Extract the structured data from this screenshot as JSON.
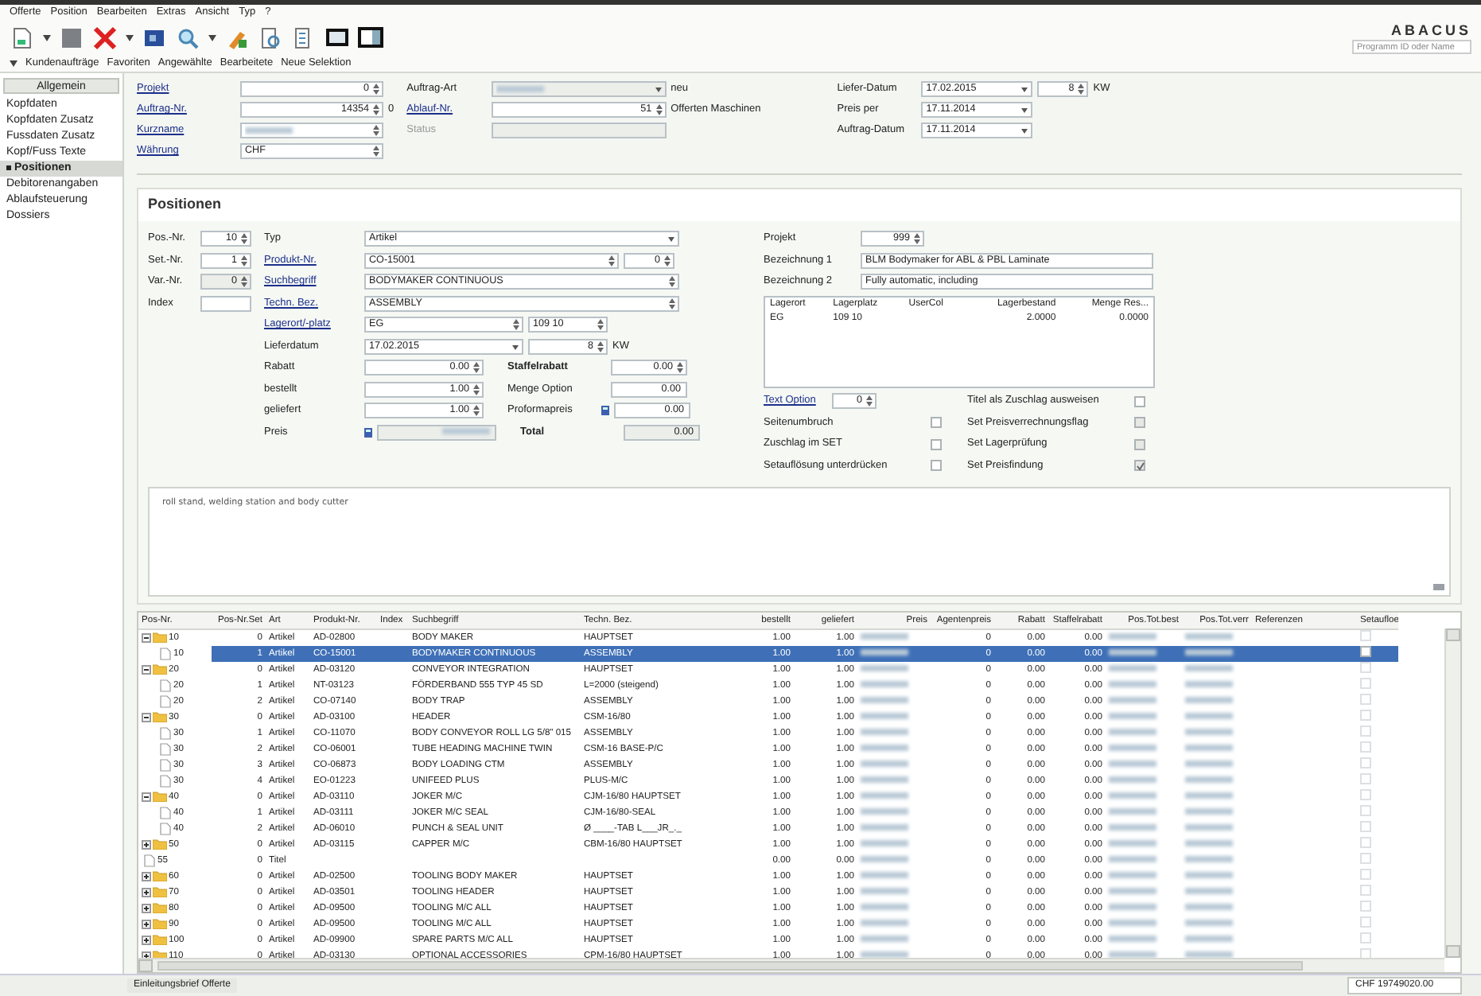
{
  "menu": [
    "Offerte",
    "Position",
    "Bearbeiten",
    "Extras",
    "Ansicht",
    "Typ",
    "?"
  ],
  "nav_tabs": [
    "Kundenaufträge",
    "Favoriten",
    "Angewählte",
    "Bearbeitete",
    "Neue Selektion"
  ],
  "logo": "ABACUS",
  "program_search": {
    "placeholder": "Programm ID oder Name"
  },
  "sidebar": {
    "header": "Allgemein",
    "items": [
      {
        "label": "Kopfdaten",
        "selected": false
      },
      {
        "label": "Kopfdaten Zusatz",
        "selected": false
      },
      {
        "label": "Fussdaten Zusatz",
        "selected": false
      },
      {
        "label": "Kopf/Fuss Texte",
        "selected": false
      },
      {
        "label": "Positionen",
        "selected": true
      },
      {
        "label": "Debitorenangaben",
        "selected": false
      },
      {
        "label": "Ablaufsteuerung",
        "selected": false
      },
      {
        "label": "Dossiers",
        "selected": false
      }
    ]
  },
  "header": {
    "groups": [
      [
        {
          "label": "Projekt",
          "link": true,
          "inputs": [
            {
              "kind": "spin",
              "value": "0"
            }
          ]
        },
        {
          "label": "Auftrag-Nr.",
          "link": true,
          "inputs": [
            {
              "kind": "spin",
              "value": "14354"
            }
          ],
          "suffix": "0"
        },
        {
          "label": "Kurzname",
          "link": true,
          "inputs": [
            {
              "kind": "lookup",
              "redacted": true
            }
          ]
        },
        {
          "label": "Währung",
          "link": true,
          "inputs": [
            {
              "kind": "lookup",
              "value": "CHF"
            }
          ]
        }
      ],
      [
        {
          "label": "Auftrag-Art",
          "inputs": [
            {
              "kind": "combo",
              "disabled": true,
              "redacted": true
            }
          ],
          "suffix": "neu"
        },
        {
          "label": "Ablauf-Nr.",
          "link": true,
          "inputs": [
            {
              "kind": "spin",
              "value": "51"
            }
          ],
          "suffix": "Offerten Maschinen"
        },
        {
          "label": "Status",
          "disabled": true,
          "inputs": [
            {
              "kind": "text",
              "disabled": true
            }
          ]
        }
      ],
      [
        {
          "label": "Liefer-Datum",
          "inputs": [
            {
              "kind": "date",
              "value": "17.02.2015"
            },
            {
              "kind": "spin",
              "value": "8"
            }
          ],
          "suffix": "KW"
        },
        {
          "label": "Preis per",
          "inputs": [
            {
              "kind": "date",
              "value": "17.11.2014"
            }
          ]
        },
        {
          "label": "Auftrag-Datum",
          "inputs": [
            {
              "kind": "date",
              "value": "17.11.2014"
            }
          ]
        }
      ]
    ]
  },
  "positionen": {
    "title": "Positionen",
    "pos_fields": [
      {
        "label": "Pos.-Nr.",
        "inputs": [
          {
            "kind": "spin",
            "value": "10"
          }
        ]
      },
      {
        "label": "Set.-Nr.",
        "inputs": [
          {
            "kind": "spin",
            "value": "1"
          }
        ]
      },
      {
        "label": "Var.-Nr.",
        "inputs": [
          {
            "kind": "spin",
            "value": "0",
            "disabled": true
          }
        ]
      },
      {
        "label": "Index",
        "inputs": [
          {
            "kind": "text"
          }
        ]
      }
    ],
    "item_fields": [
      {
        "label": "Typ",
        "inputs": [
          {
            "kind": "combo",
            "value": "Artikel"
          }
        ]
      },
      {
        "label": "Produkt-Nr.",
        "link": true,
        "inputs": [
          {
            "kind": "lookup",
            "value": "CO-15001"
          },
          {
            "kind": "spin",
            "value": "0"
          }
        ]
      },
      {
        "label": "Suchbegriff",
        "link": true,
        "inputs": [
          {
            "kind": "lookup",
            "value": "BODYMAKER CONTINUOUS"
          }
        ]
      },
      {
        "label": "Techn. Bez.",
        "link": true,
        "inputs": [
          {
            "kind": "lookup",
            "value": "ASSEMBLY"
          }
        ]
      },
      {
        "label": "Lagerort/-platz",
        "link": true,
        "inputs": [
          {
            "kind": "lookup",
            "value": "EG"
          },
          {
            "kind": "lookup",
            "value": "109 10"
          }
        ]
      },
      {
        "label": "Lieferdatum",
        "inputs": [
          {
            "kind": "date",
            "value": "17.02.2015"
          },
          {
            "kind": "spin",
            "value": "8"
          }
        ],
        "suffix": "KW"
      },
      {
        "label": "Rabatt",
        "inputs": [
          {
            "kind": "spin",
            "value": "0.00"
          }
        ],
        "side": {
          "label": "Staffelrabatt",
          "bold": true,
          "inputs": [
            {
              "kind": "spin",
              "value": "0.00"
            }
          ]
        }
      },
      {
        "label": "bestellt",
        "inputs": [
          {
            "kind": "spin",
            "value": "1.00"
          }
        ],
        "side": {
          "label": "Menge Option",
          "inputs": [
            {
              "kind": "num",
              "value": "0.00"
            }
          ]
        }
      },
      {
        "label": "geliefert",
        "inputs": [
          {
            "kind": "spin",
            "value": "1.00"
          }
        ],
        "side": {
          "label": "Proformapreis",
          "label_icon": true,
          "inputs": [
            {
              "kind": "num",
              "value": "0.00"
            }
          ]
        }
      },
      {
        "label": "Preis",
        "label_icon": true,
        "inputs": [
          {
            "kind": "num",
            "disabled": true,
            "redacted": true
          }
        ],
        "side": {
          "label": "Total",
          "bold": true,
          "inputs": [
            {
              "kind": "num",
              "value": "0.00",
              "disabled": true
            }
          ]
        }
      }
    ],
    "right_fields": [
      {
        "label": "Projekt",
        "inputs": [
          {
            "kind": "spin",
            "value": "999"
          }
        ]
      },
      {
        "label": "Bezeichnung 1",
        "inputs": [
          {
            "kind": "text",
            "value": "BLM Bodymaker for ABL & PBL Laminate"
          }
        ]
      },
      {
        "label": "Bezeichnung 2",
        "inputs": [
          {
            "kind": "text",
            "value": "Fully automatic, including"
          }
        ]
      }
    ],
    "stock_table": {
      "columns": [
        "Lagerort",
        "Lagerplatz",
        "UserCol",
        "Lagerbestand",
        "Menge Res..."
      ],
      "rows": [
        [
          "EG",
          "109 10",
          null,
          "2.0000",
          "0.0000"
        ]
      ]
    },
    "text_option": {
      "label": "Text Option",
      "link": true,
      "value": "0"
    },
    "checks_left": [
      {
        "label": "Seitenumbruch",
        "checked": false,
        "disabled": false
      },
      {
        "label": "Zuschlag im SET",
        "checked": false,
        "disabled": false
      },
      {
        "label": "Setauflösung unterdrücken",
        "checked": false,
        "disabled": false
      }
    ],
    "checks_right": [
      {
        "label": "Titel als Zuschlag ausweisen",
        "checked": false,
        "disabled": false
      },
      {
        "label": "Set Preisverrechnungsflag",
        "checked": false,
        "disabled": true
      },
      {
        "label": "Set Lagerprüfung",
        "checked": false,
        "disabled": true
      },
      {
        "label": "Set Preisfindung",
        "checked": true,
        "disabled": true
      }
    ],
    "text": "roll stand, welding station and body cutter"
  },
  "grid": {
    "columns": [
      {
        "label": "Pos-Nr.",
        "kind": "tree"
      },
      {
        "label": "Pos-Nr.Set",
        "kind": "num"
      },
      {
        "label": "Art",
        "kind": "text"
      },
      {
        "label": "Produkt-Nr.",
        "kind": "text"
      },
      {
        "label": "Index",
        "kind": "empty"
      },
      {
        "label": "Suchbegriff",
        "kind": "text"
      },
      {
        "label": "Techn. Bez.",
        "kind": "text"
      },
      {
        "label": "bestellt",
        "kind": "num"
      },
      {
        "label": "geliefert",
        "kind": "num"
      },
      {
        "label": "Preis",
        "kind": "blurred"
      },
      {
        "label": "Agentenpreis",
        "kind": "num"
      },
      {
        "label": "Rabatt",
        "kind": "num"
      },
      {
        "label": "Staffelrabatt",
        "kind": "num"
      },
      {
        "label": "Pos.Tot.best",
        "kind": "blurred"
      },
      {
        "label": "Pos.Tot.verr",
        "kind": "blurred"
      },
      {
        "label": "Referenzen",
        "kind": "empty"
      },
      {
        "label": "Setaufloe",
        "kind": "check"
      }
    ],
    "rows": [
      {
        "cells": [
          "10",
          "0",
          "Artikel",
          "AD-02800",
          "",
          "BODY MAKER",
          "HAUPTSET",
          "1.00",
          "1.00",
          "",
          "0",
          "0.00",
          "0.00",
          "",
          "",
          "",
          ""
        ],
        "expanded": true,
        "selected": false,
        "checked": false,
        "children": [
          {
            "cells": [
              "10",
              "1",
              "Artikel",
              "CO-15001",
              "",
              "BODYMAKER CONTINUOUS",
              "ASSEMBLY",
              "1.00",
              "1.00",
              "",
              "0",
              "0.00",
              "0.00",
              "",
              "",
              "",
              ""
            ],
            "selected": true,
            "checked": false
          }
        ]
      },
      {
        "cells": [
          "20",
          "0",
          "Artikel",
          "AD-03120",
          "",
          "CONVEYOR INTEGRATION",
          "HAUPTSET",
          "1.00",
          "1.00",
          "",
          "0",
          "0.00",
          "0.00",
          "",
          "",
          "",
          ""
        ],
        "expanded": true,
        "selected": false,
        "checked": false,
        "children": [
          {
            "cells": [
              "20",
              "1",
              "Artikel",
              "NT-03123",
              "",
              "FÖRDERBAND 555 TYP 45 SD",
              "L=2000 (steigend)",
              "1.00",
              "1.00",
              "",
              "0",
              "0.00",
              "0.00",
              "",
              "",
              "",
              ""
            ],
            "selected": false,
            "checked": false
          },
          {
            "cells": [
              "20",
              "2",
              "Artikel",
              "CO-07140",
              "",
              "BODY TRAP",
              "ASSEMBLY",
              "1.00",
              "1.00",
              "",
              "0",
              "0.00",
              "0.00",
              "",
              "",
              "",
              ""
            ],
            "selected": false,
            "checked": false
          }
        ]
      },
      {
        "cells": [
          "30",
          "0",
          "Artikel",
          "AD-03100",
          "",
          "HEADER",
          "CSM-16/80",
          "1.00",
          "1.00",
          "",
          "0",
          "0.00",
          "0.00",
          "",
          "",
          "",
          ""
        ],
        "expanded": true,
        "selected": false,
        "checked": false,
        "children": [
          {
            "cells": [
              "30",
              "1",
              "Artikel",
              "CO-11070",
              "",
              "BODY CONVEYOR ROLL LG 5/8\" 015",
              "ASSEMBLY",
              "1.00",
              "1.00",
              "",
              "0",
              "0.00",
              "0.00",
              "",
              "",
              "",
              ""
            ],
            "selected": false,
            "checked": false
          },
          {
            "cells": [
              "30",
              "2",
              "Artikel",
              "CO-06001",
              "",
              "TUBE HEADING MACHINE TWIN",
              "CSM-16  BASE-P/C",
              "1.00",
              "1.00",
              "",
              "0",
              "0.00",
              "0.00",
              "",
              "",
              "",
              ""
            ],
            "selected": false,
            "checked": false
          },
          {
            "cells": [
              "30",
              "3",
              "Artikel",
              "CO-06873",
              "",
              "BODY LOADING    CTM",
              "ASSEMBLY",
              "1.00",
              "1.00",
              "",
              "0",
              "0.00",
              "0.00",
              "",
              "",
              "",
              ""
            ],
            "selected": false,
            "checked": false
          },
          {
            "cells": [
              "30",
              "4",
              "Artikel",
              "EO-01223",
              "",
              "UNIFEED PLUS",
              "PLUS-M/C",
              "1.00",
              "1.00",
              "",
              "0",
              "0.00",
              "0.00",
              "",
              "",
              "",
              ""
            ],
            "selected": false,
            "checked": false
          }
        ]
      },
      {
        "cells": [
          "40",
          "0",
          "Artikel",
          "AD-03110",
          "",
          "JOKER M/C",
          "CJM-16/80  HAUPTSET",
          "1.00",
          "1.00",
          "",
          "0",
          "0.00",
          "0.00",
          "",
          "",
          "",
          ""
        ],
        "expanded": true,
        "selected": false,
        "checked": false,
        "children": [
          {
            "cells": [
              "40",
              "1",
              "Artikel",
              "AD-03111",
              "",
              "JOKER M/C SEAL",
              "CJM-16/80-SEAL",
              "1.00",
              "1.00",
              "",
              "0",
              "0.00",
              "0.00",
              "",
              "",
              "",
              ""
            ],
            "selected": false,
            "checked": false
          },
          {
            "cells": [
              "40",
              "2",
              "Artikel",
              "AD-06010",
              "",
              "PUNCH & SEAL UNIT",
              "Ø ____-TAB L___JR_._",
              "1.00",
              "1.00",
              "",
              "0",
              "0.00",
              "0.00",
              "",
              "",
              "",
              ""
            ],
            "selected": false,
            "checked": false
          }
        ]
      },
      {
        "cells": [
          "50",
          "0",
          "Artikel",
          "AD-03115",
          "",
          "CAPPER M/C",
          "CBM-16/80  HAUPTSET",
          "1.00",
          "1.00",
          "",
          "0",
          "0.00",
          "0.00",
          "",
          "",
          "",
          ""
        ],
        "expanded": false,
        "selected": false,
        "checked": false
      },
      {
        "cells": [
          "55",
          "0",
          "Titel",
          "",
          "",
          "",
          "",
          "0.00",
          "0.00",
          "",
          "0",
          "0.00",
          "0.00",
          "",
          "",
          "",
          ""
        ],
        "selected": false,
        "checked": false
      },
      {
        "cells": [
          "60",
          "0",
          "Artikel",
          "AD-02500",
          "",
          "TOOLING BODY MAKER",
          "HAUPTSET",
          "1.00",
          "1.00",
          "",
          "0",
          "0.00",
          "0.00",
          "",
          "",
          "",
          ""
        ],
        "expanded": false,
        "selected": false,
        "checked": false
      },
      {
        "cells": [
          "70",
          "0",
          "Artikel",
          "AD-03501",
          "",
          "TOOLING HEADER",
          "HAUPTSET",
          "1.00",
          "1.00",
          "",
          "0",
          "0.00",
          "0.00",
          "",
          "",
          "",
          ""
        ],
        "expanded": false,
        "selected": false,
        "checked": false
      },
      {
        "cells": [
          "80",
          "0",
          "Artikel",
          "AD-09500",
          "",
          "TOOLING M/C ALL",
          "HAUPTSET",
          "1.00",
          "1.00",
          "",
          "0",
          "0.00",
          "0.00",
          "",
          "",
          "",
          ""
        ],
        "expanded": false,
        "selected": false,
        "checked": false
      },
      {
        "cells": [
          "90",
          "0",
          "Artikel",
          "AD-09500",
          "",
          "TOOLING M/C ALL",
          "HAUPTSET",
          "1.00",
          "1.00",
          "",
          "0",
          "0.00",
          "0.00",
          "",
          "",
          "",
          ""
        ],
        "expanded": false,
        "selected": false,
        "checked": false
      },
      {
        "cells": [
          "100",
          "0",
          "Artikel",
          "AD-09900",
          "",
          "SPARE PARTS M/C ALL",
          "HAUPTSET",
          "1.00",
          "1.00",
          "",
          "0",
          "0.00",
          "0.00",
          "",
          "",
          "",
          ""
        ],
        "expanded": false,
        "selected": false,
        "checked": false
      },
      {
        "cells": [
          "110",
          "0",
          "Artikel",
          "AD-03130",
          "",
          "OPTIONAL ACCESSORIES",
          "CPM-16/80  HAUPTSET",
          "1.00",
          "1.00",
          "",
          "0",
          "0.00",
          "0.00",
          "",
          "",
          "",
          ""
        ],
        "expanded": false,
        "selected": false,
        "checked": false
      }
    ]
  },
  "status_bar": {
    "left": "Einleitungsbrief Offerte",
    "right": "CHF 19749020.00"
  }
}
